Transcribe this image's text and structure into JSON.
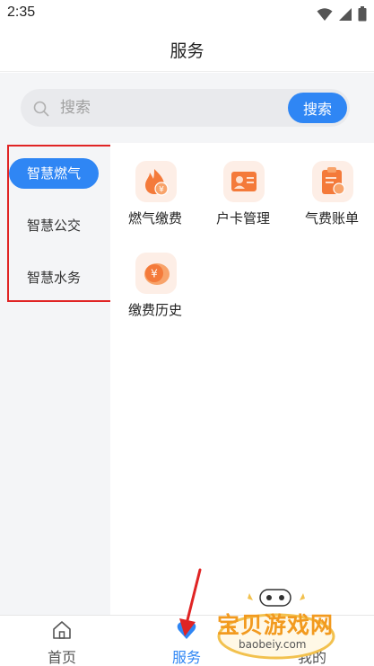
{
  "status_bar": {
    "time": "2:35"
  },
  "header": {
    "title": "服务"
  },
  "search": {
    "placeholder": "搜索",
    "button_label": "搜索"
  },
  "sidebar": {
    "items": [
      {
        "label": "智慧燃气",
        "active": true
      },
      {
        "label": "智慧公交",
        "active": false
      },
      {
        "label": "智慧水务",
        "active": false
      }
    ]
  },
  "services": [
    {
      "label": "燃气缴费",
      "icon": "gas-flame-icon"
    },
    {
      "label": "户卡管理",
      "icon": "user-card-icon"
    },
    {
      "label": "气费账单",
      "icon": "bill-clipboard-icon"
    },
    {
      "label": "缴费历史",
      "icon": "payment-coin-icon"
    }
  ],
  "bottom_nav": {
    "tabs": [
      {
        "label": "首页",
        "icon": "home-icon",
        "active": false
      },
      {
        "label": "服务",
        "icon": "heart-icon",
        "active": true
      },
      {
        "label": "我的",
        "icon": "profile-icon",
        "active": false
      }
    ]
  },
  "watermark": {
    "text": "宝贝游戏网",
    "url_text": "baobeiy.com"
  },
  "colors": {
    "accent": "#2f86f4",
    "icon_orange": "#f47a3a",
    "icon_bg": "#fdeee6",
    "annotation_red": "#e02424"
  }
}
